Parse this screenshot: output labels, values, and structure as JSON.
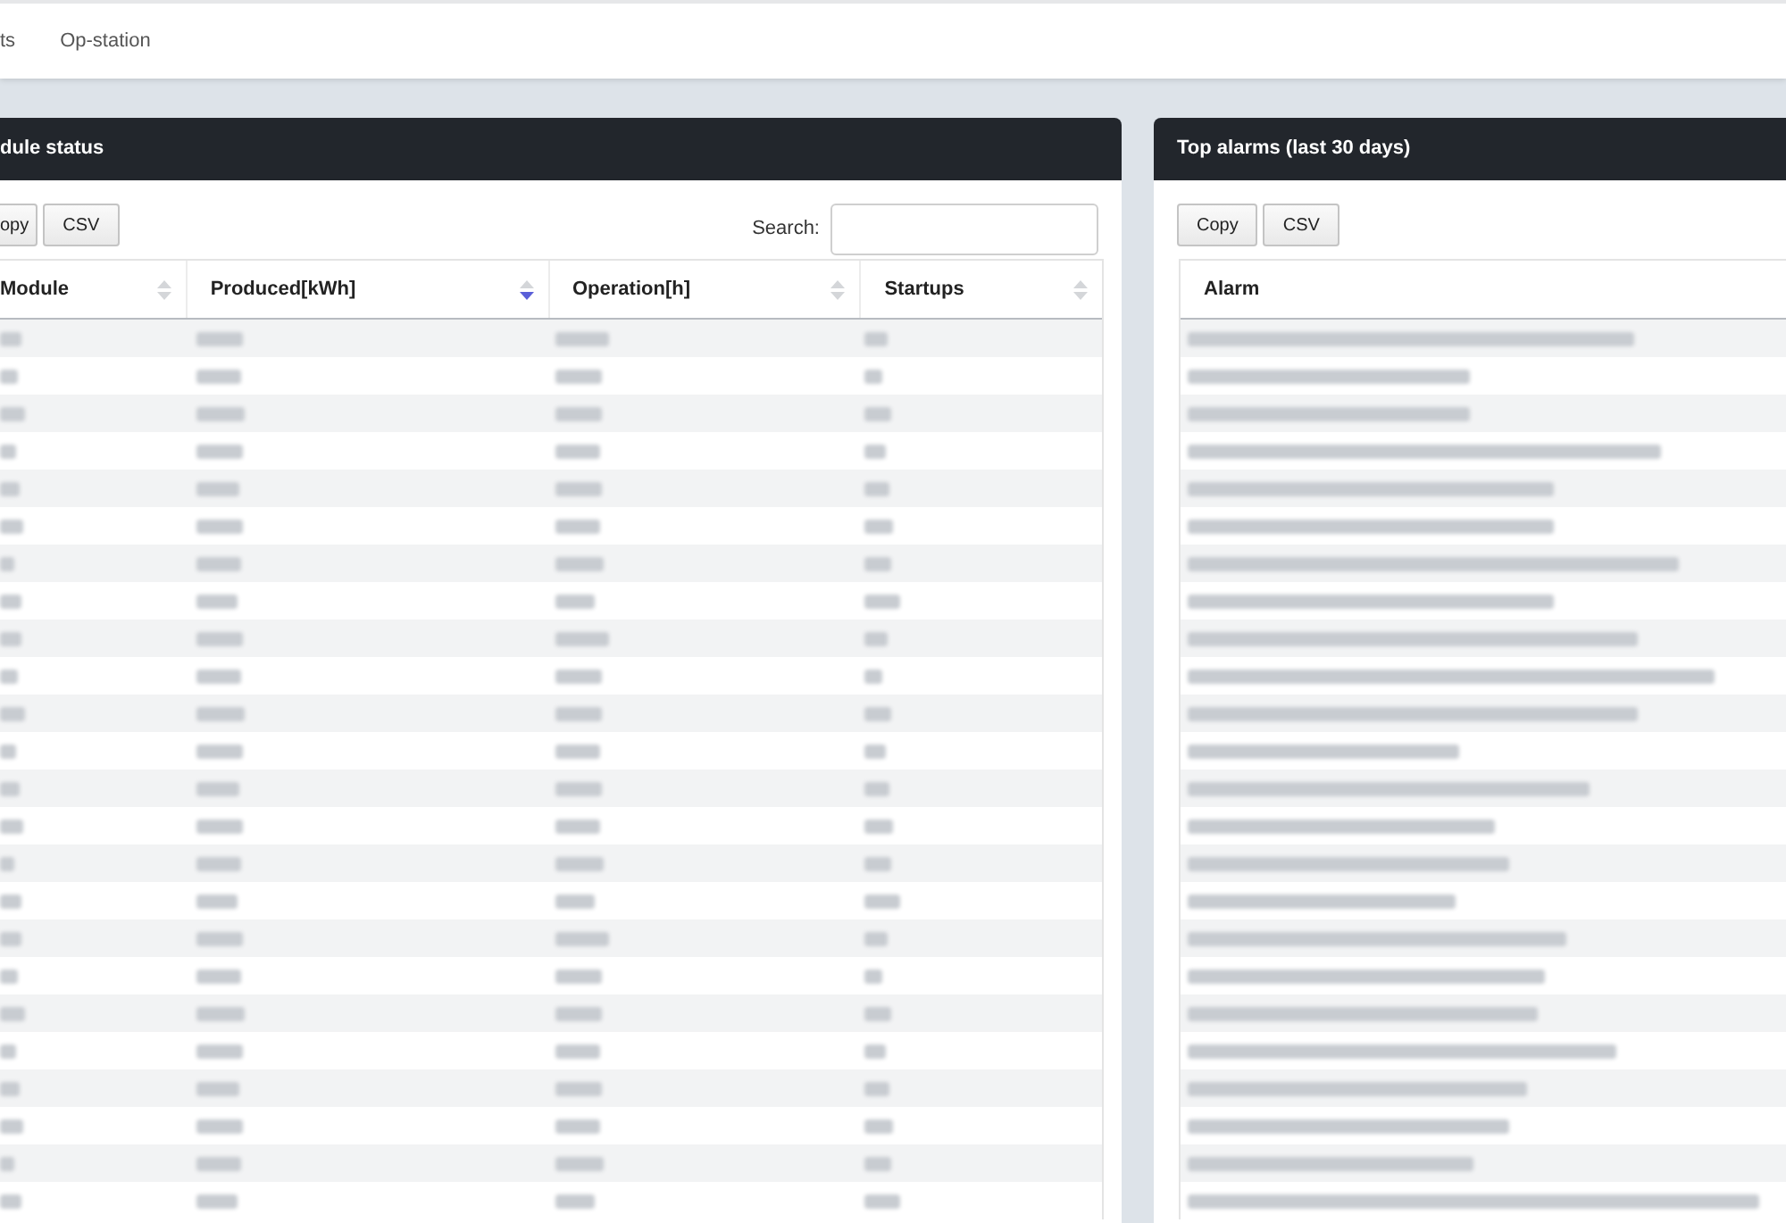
{
  "nav": {
    "links": [
      "ts",
      "Op-station"
    ]
  },
  "panels": [
    {
      "title": "dule status",
      "buttons": [
        "opy",
        "CSV"
      ],
      "search": {
        "label": "Search:"
      },
      "table": {
        "columns": [
          {
            "label": "Module",
            "sorted": false
          },
          {
            "label": "Produced[kWh]",
            "sorted": true
          },
          {
            "label": "Operation[h]",
            "sorted": false
          },
          {
            "label": "Startups",
            "sorted": false
          }
        ],
        "rows": [
          {
            "redacted": true
          },
          {
            "redacted": true
          },
          {
            "redacted": true
          },
          {
            "redacted": true
          },
          {
            "redacted": true
          },
          {
            "redacted": true
          },
          {
            "redacted": true
          },
          {
            "redacted": true
          },
          {
            "redacted": true
          },
          {
            "redacted": true
          },
          {
            "redacted": true
          },
          {
            "redacted": true
          },
          {
            "redacted": true
          },
          {
            "redacted": true
          },
          {
            "redacted": true
          },
          {
            "redacted": true
          },
          {
            "redacted": true
          },
          {
            "redacted": true
          },
          {
            "redacted": true
          },
          {
            "redacted": true
          },
          {
            "redacted": true
          },
          {
            "redacted": true
          },
          {
            "redacted": true
          },
          {
            "redacted": true
          }
        ]
      }
    },
    {
      "title": "Top alarms (last 30 days)",
      "buttons": [
        "Copy",
        "CSV"
      ],
      "table": {
        "columns": [
          {
            "label": "Alarm"
          }
        ],
        "rows": [
          {
            "redacted": true
          },
          {
            "redacted": true
          },
          {
            "redacted": true
          },
          {
            "redacted": true
          },
          {
            "redacted": true
          },
          {
            "redacted": true
          },
          {
            "redacted": true
          },
          {
            "redacted": true
          },
          {
            "redacted": true
          },
          {
            "redacted": true
          },
          {
            "redacted": true
          },
          {
            "redacted": true
          },
          {
            "redacted": true
          },
          {
            "redacted": true
          },
          {
            "redacted": true
          },
          {
            "redacted": true
          },
          {
            "redacted": true
          },
          {
            "redacted": true
          },
          {
            "redacted": true
          },
          {
            "redacted": true
          },
          {
            "redacted": true
          },
          {
            "redacted": true
          },
          {
            "redacted": true
          },
          {
            "redacted": true
          }
        ]
      }
    }
  ]
}
